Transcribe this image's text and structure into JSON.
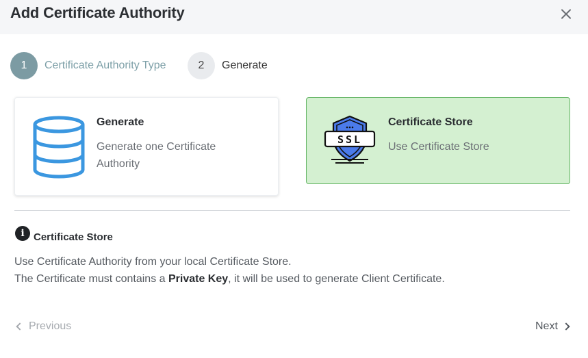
{
  "dialog": {
    "title": "Add Certificate Authority"
  },
  "steps": [
    {
      "number": "1",
      "label": "Certificate Authority Type"
    },
    {
      "number": "2",
      "label": "Generate"
    }
  ],
  "cards": {
    "generate": {
      "title": "Generate",
      "description": "Generate one Certificate Authority",
      "icon": "database-icon",
      "selected": false
    },
    "store": {
      "title": "Certificate Store",
      "description": "Use Certificate Store",
      "icon": "ssl-shield-icon",
      "icon_text": "SSL",
      "selected": true
    }
  },
  "info": {
    "title": "Certificate Store",
    "line1": "Use Certificate Authority from your local Certificate Store.",
    "line2_before": "The Certificate must contains a ",
    "line2_bold": "Private Key",
    "line2_after": ", it will be used to generate Client Certificate."
  },
  "footer": {
    "previous_label": "Previous",
    "next_label": "Next"
  },
  "colors": {
    "accent_step": "#7c9ba3",
    "selected_bg": "#d4f0d1",
    "selected_border": "#63b463",
    "database_blue": "#3b97e0",
    "shield_blue": "#4b7bea"
  }
}
